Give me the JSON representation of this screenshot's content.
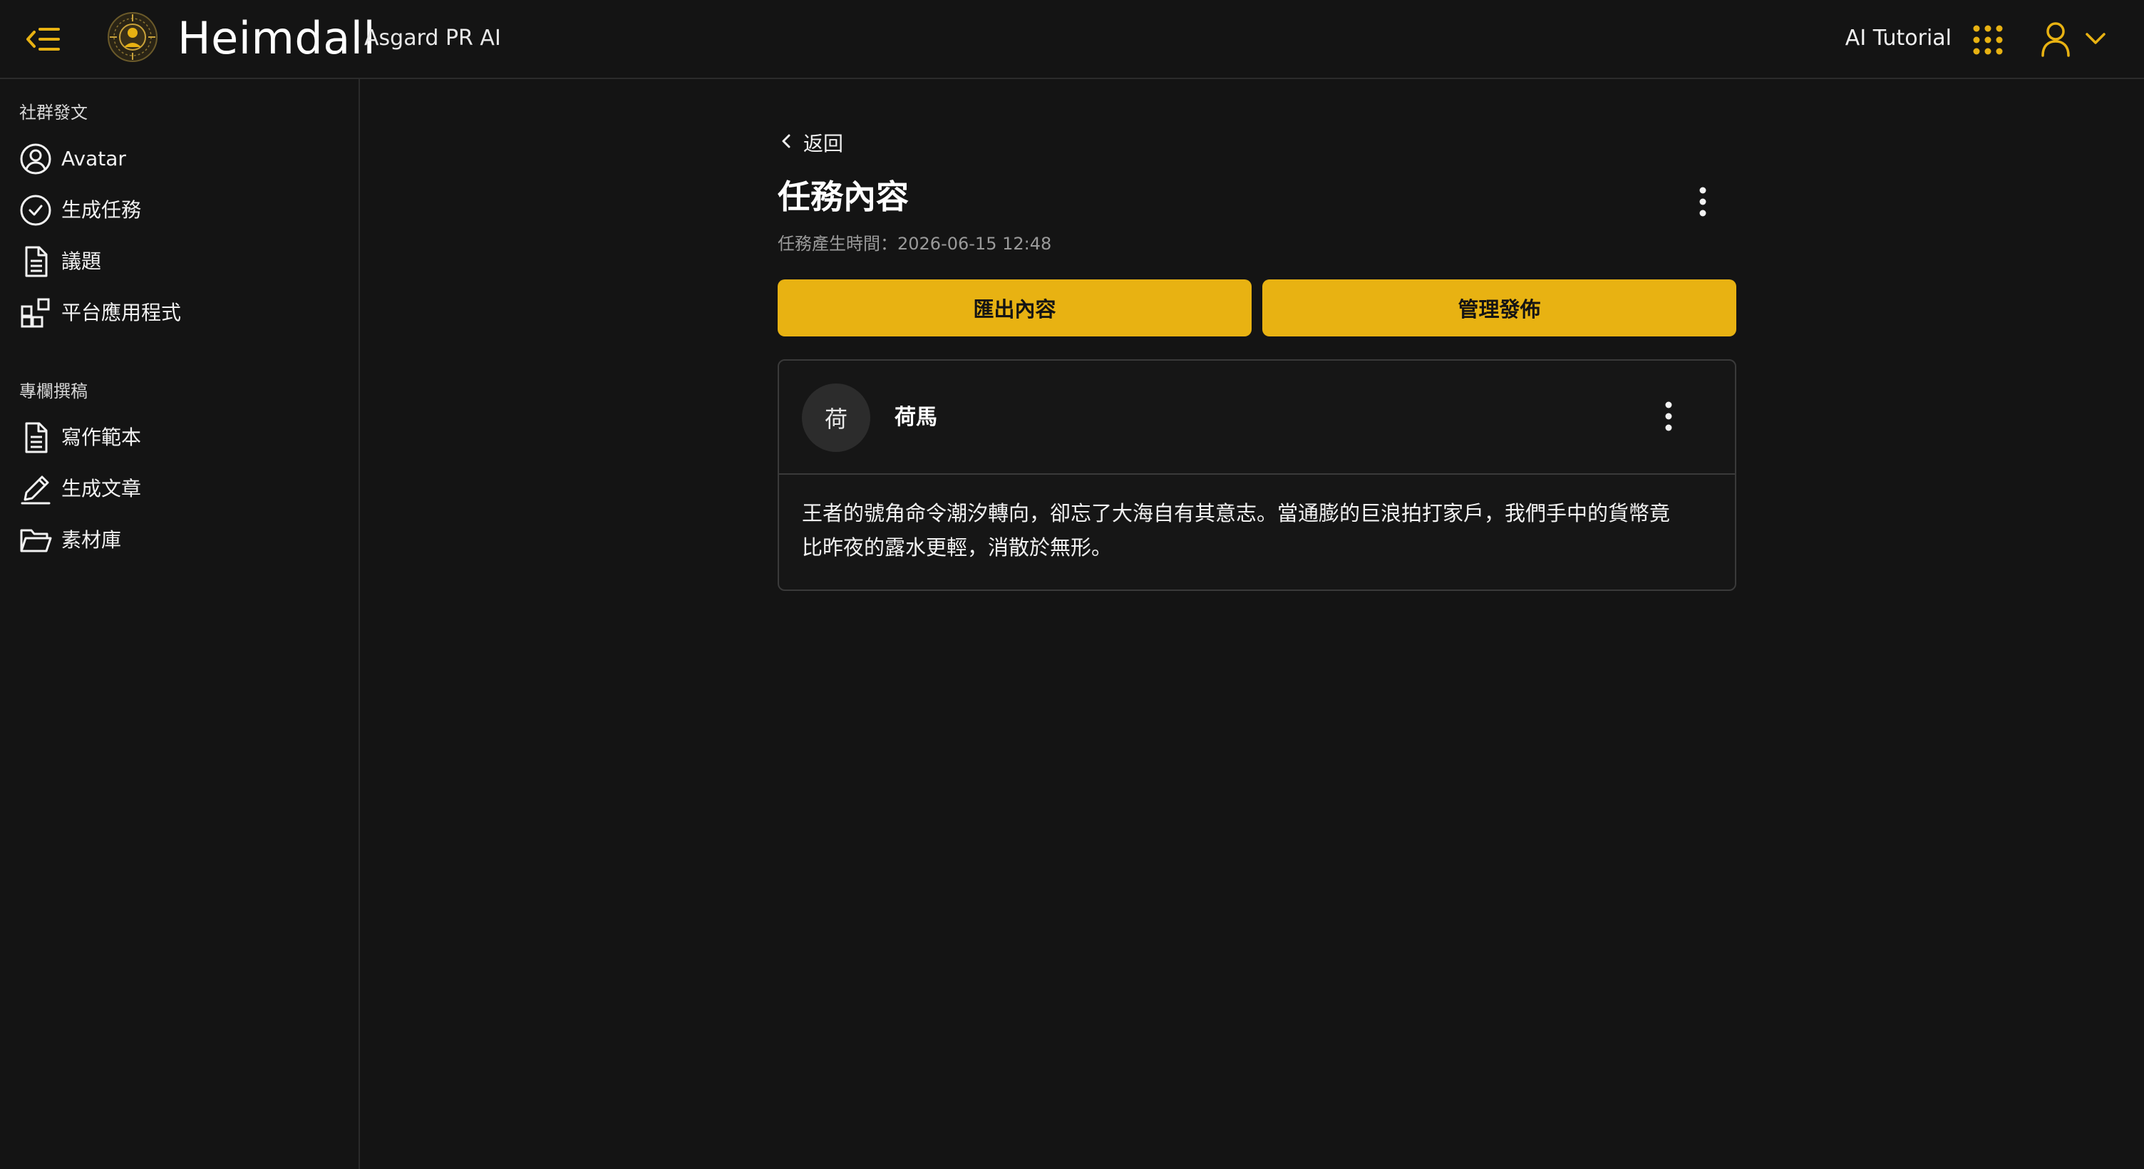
{
  "header": {
    "brand_name": "Heimdall",
    "brand_sub": "Asgard PR AI",
    "tutorial_label": "AI Tutorial",
    "accent_color": "#e8b212",
    "icons": [
      "menu-collapse-icon",
      "heimdall-logo",
      "apps-grid-icon",
      "user-icon",
      "chevron-down-icon"
    ]
  },
  "sidebar": {
    "sections": [
      {
        "title": "社群發文",
        "items": [
          {
            "label": "Avatar",
            "icon": "user-circle-icon"
          },
          {
            "label": "生成任務",
            "icon": "check-circle-icon"
          },
          {
            "label": "議題",
            "icon": "document-icon"
          },
          {
            "label": "平台應用程式",
            "icon": "apps-icon"
          }
        ]
      },
      {
        "title": "專欄撰稿",
        "items": [
          {
            "label": "寫作範本",
            "icon": "document-icon"
          },
          {
            "label": "生成文章",
            "icon": "pen-icon"
          },
          {
            "label": "素材庫",
            "icon": "folder-icon"
          }
        ]
      }
    ]
  },
  "main": {
    "back_label": "返回",
    "title": "任務內容",
    "created_time": "任務產生時間：2026-06-15 12:48",
    "buttons": {
      "export": "匯出內容",
      "manage": "管理發佈"
    },
    "post": {
      "avatar_initial": "荷",
      "author": "荷馬",
      "body_line1": "王者的號角命令潮汐轉向，卻忘了大海自有其意志。當通膨的巨浪拍打家戶，我們手中的貨幣竟",
      "body_line2": "比昨夜的露水更輕，消散於無形。"
    }
  }
}
